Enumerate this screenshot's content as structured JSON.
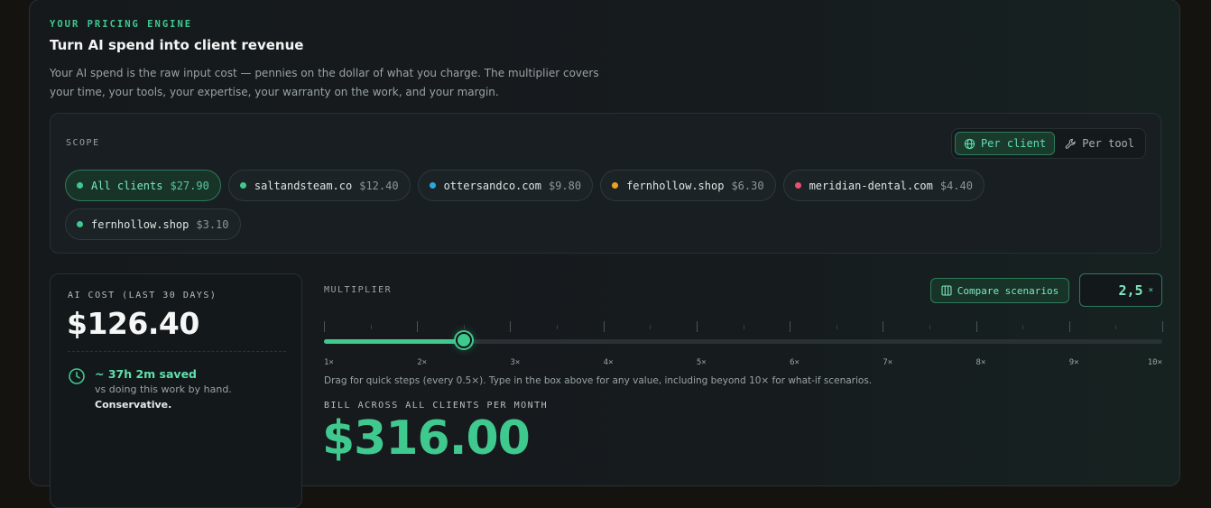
{
  "header": {
    "eyebrow": "YOUR PRICING ENGINE",
    "title": "Turn AI spend into client revenue",
    "description": "Your AI spend is the raw input cost — pennies on the dollar of what you charge. The multiplier covers your time, your tools, your expertise, your warranty on the work, and your margin."
  },
  "scope": {
    "label": "SCOPE",
    "toggle": {
      "per_client": "Per client",
      "per_tool": "Per tool",
      "active": "per_client"
    },
    "chips": [
      {
        "name": "All clients",
        "amount": "$27.90",
        "color": "#3fc98f",
        "active": true
      },
      {
        "name": "saltandsteam.co",
        "amount": "$12.40",
        "color": "#3fc98f",
        "active": false
      },
      {
        "name": "ottersandco.com",
        "amount": "$9.80",
        "color": "#29a8e0",
        "active": false
      },
      {
        "name": "fernhollow.shop",
        "amount": "$6.30",
        "color": "#f0a020",
        "active": false
      },
      {
        "name": "meridian-dental.com",
        "amount": "$4.40",
        "color": "#e8506a",
        "active": false
      },
      {
        "name": "fernhollow.shop",
        "amount": "$3.10",
        "color": "#3fc98f",
        "active": false
      }
    ]
  },
  "cost": {
    "label": "AI COST (LAST 30 DAYS)",
    "value": "$126.40",
    "saved_title": "~ 37h 2m saved",
    "saved_sub": "vs doing this work by hand.",
    "saved_note": "Conservative."
  },
  "multiplier": {
    "label": "MULTIPLIER",
    "compare_label": "Compare scenarios",
    "value_display": "2,5",
    "unit": "×",
    "value": 2.5,
    "min": 1,
    "max": 10,
    "tick_labels": [
      "1×",
      "2×",
      "3×",
      "4×",
      "5×",
      "6×",
      "7×",
      "8×",
      "9×",
      "10×"
    ],
    "hint": "Drag for quick steps (every 0.5×). Type in the box above for any value, including beyond 10× for what-if scenarios."
  },
  "bill": {
    "label": "BILL ACROSS ALL CLIENTS PER MONTH",
    "value": "$316.00"
  },
  "colors": {
    "accent": "#3fc98f",
    "background": "#15191c"
  }
}
